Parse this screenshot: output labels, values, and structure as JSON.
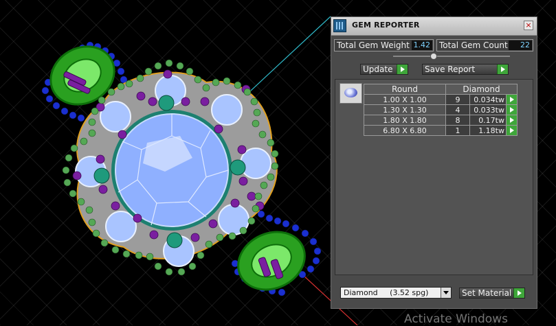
{
  "panel": {
    "title": "GEM REPORTER",
    "close_glyph": "×",
    "total_weight_label": "Total Gem Weight",
    "total_weight_value": "1.42",
    "total_count_label": "Total Gem Count",
    "total_count_value": "22",
    "update_label": "Update",
    "save_report_label": "Save Report",
    "table": {
      "headers": [
        "Round",
        "Diamond"
      ],
      "rows": [
        {
          "size": "1.00 X 1.00",
          "count": "9",
          "weight": "0.034tw"
        },
        {
          "size": "1.30 X 1.30",
          "count": "4",
          "weight": "0.033tw"
        },
        {
          "size": "1.80 X 1.80",
          "count": "8",
          "weight": "0.17tw"
        },
        {
          "size": "6.80 X 6.80",
          "count": "1",
          "weight": "1.18tw"
        }
      ]
    },
    "material_select": "Diamond     (3.52 spg)",
    "set_material_label": "Set Material",
    "icons": {
      "app": "gem-reporter-app-icon",
      "close": "close-icon",
      "arrow": "play-arrow-icon",
      "dropdown": "chevron-down-icon",
      "gem": "round-gem-icon"
    },
    "colors": {
      "panel_bg": "#4a4a4a",
      "value_text": "#7fd3ff",
      "arrow_green": "#3fa63a"
    }
  },
  "viewport": {
    "colors": {
      "center_stone": "#8fb0ff",
      "halo_green": "#44c23a",
      "purple_prong": "#7a1fa0",
      "blue_bead": "#1a2fd0"
    }
  },
  "watermark": "Activate Windows"
}
